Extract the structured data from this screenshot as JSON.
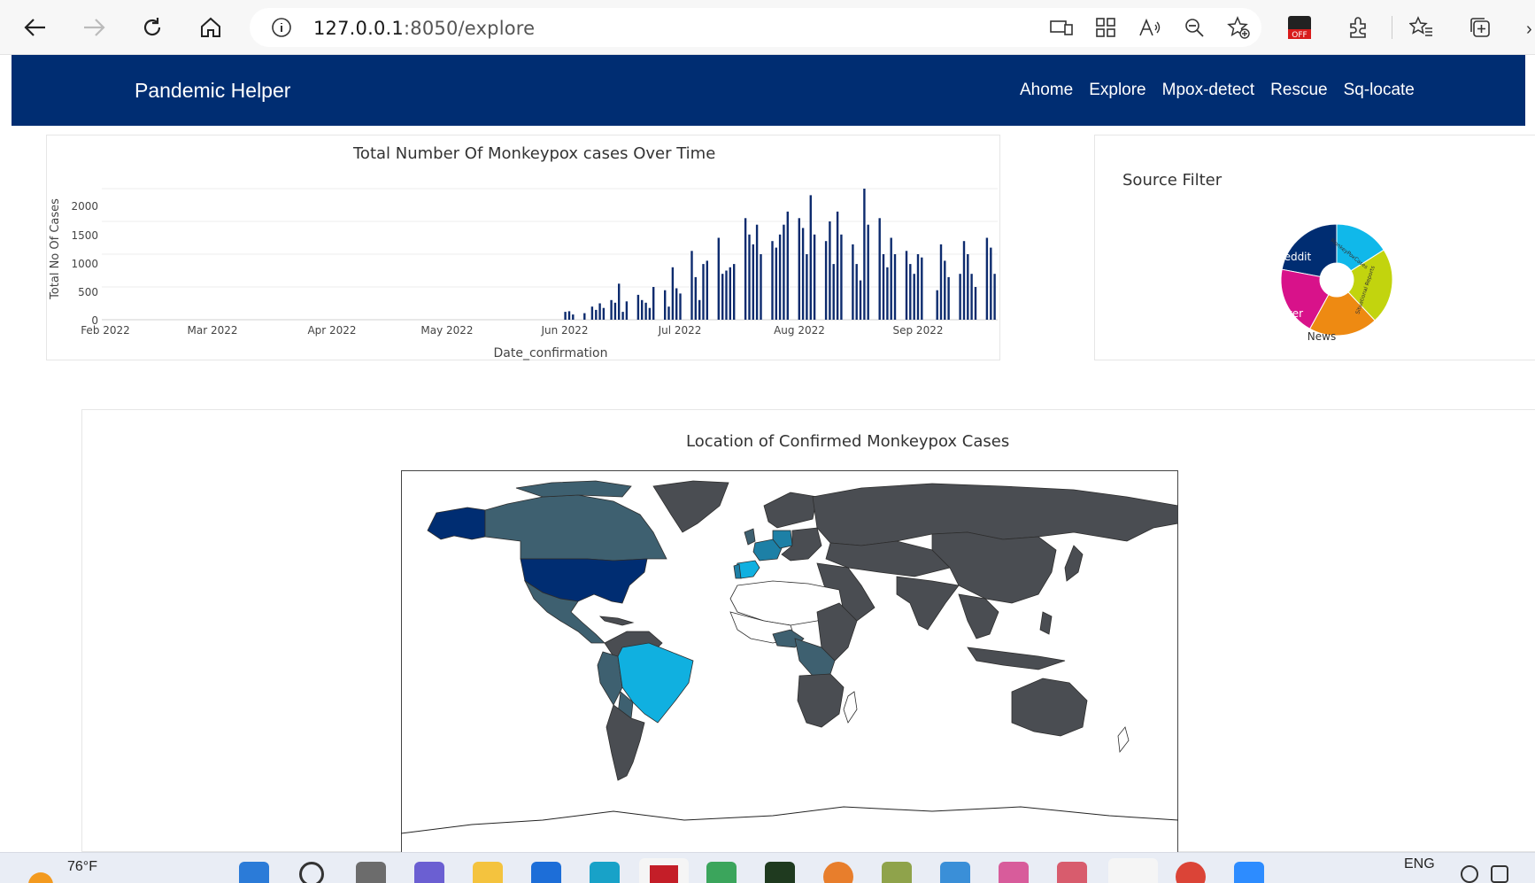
{
  "browser": {
    "url_host": "127.0.0.1",
    "url_rest": ":8050/explore",
    "ext_badge": "OFF"
  },
  "navbar": {
    "brand": "Pandemic Helper",
    "links": [
      "Ahome",
      "Explore",
      "Mpox-detect",
      "Rescue",
      "Sq-locate"
    ]
  },
  "timeline": {
    "title": "Total Number Of Monkeypox cases Over Time",
    "xlabel": "Date_confirmation",
    "ylabel": "Total No Of Cases",
    "yticks": [
      "0",
      "500",
      "1000",
      "1500",
      "2000"
    ],
    "xticks": [
      "Feb 2022",
      "Mar 2022",
      "Apr 2022",
      "May 2022",
      "Jun 2022",
      "Jul 2022",
      "Aug 2022",
      "Sep 2022"
    ]
  },
  "source_filter": {
    "title": "Source Filter",
    "labels": [
      "Reddit",
      "MonkeyPoxCases",
      "Situational Reports",
      "News",
      "Twitter"
    ]
  },
  "map": {
    "title": "Location of Confirmed Monkeypox Cases"
  },
  "taskbar": {
    "weather": "76°F",
    "lang": "ENG"
  },
  "chart_data": [
    {
      "type": "bar",
      "title": "Total Number Of Monkeypox cases Over Time",
      "xlabel": "Date_confirmation",
      "ylabel": "Total No Of Cases",
      "x_start": "2022-06-01",
      "ylim": [
        0,
        2000
      ],
      "x": [
        "2022-06-01",
        "2022-06-02",
        "2022-06-03",
        "2022-06-06",
        "2022-06-08",
        "2022-06-09",
        "2022-06-10",
        "2022-06-11",
        "2022-06-13",
        "2022-06-14",
        "2022-06-15",
        "2022-06-16",
        "2022-06-17",
        "2022-06-20",
        "2022-06-21",
        "2022-06-22",
        "2022-06-23",
        "2022-06-24",
        "2022-06-27",
        "2022-06-28",
        "2022-06-29",
        "2022-06-30",
        "2022-07-01",
        "2022-07-04",
        "2022-07-05",
        "2022-07-06",
        "2022-07-07",
        "2022-07-08",
        "2022-07-11",
        "2022-07-12",
        "2022-07-13",
        "2022-07-14",
        "2022-07-15",
        "2022-07-18",
        "2022-07-19",
        "2022-07-20",
        "2022-07-21",
        "2022-07-22",
        "2022-07-25",
        "2022-07-26",
        "2022-07-27",
        "2022-07-28",
        "2022-07-29",
        "2022-08-01",
        "2022-08-02",
        "2022-08-03",
        "2022-08-04",
        "2022-08-05",
        "2022-08-08",
        "2022-08-09",
        "2022-08-10",
        "2022-08-11",
        "2022-08-12",
        "2022-08-15",
        "2022-08-16",
        "2022-08-17",
        "2022-08-18",
        "2022-08-19",
        "2022-08-22",
        "2022-08-23",
        "2022-08-24",
        "2022-08-25",
        "2022-08-26",
        "2022-08-29",
        "2022-08-30",
        "2022-08-31",
        "2022-09-01",
        "2022-09-02",
        "2022-09-06",
        "2022-09-07",
        "2022-09-08",
        "2022-09-09",
        "2022-09-12",
        "2022-09-13",
        "2022-09-14",
        "2022-09-15",
        "2022-09-16",
        "2022-09-19",
        "2022-09-20",
        "2022-09-21"
      ],
      "values": [
        120,
        130,
        80,
        100,
        200,
        150,
        250,
        180,
        300,
        260,
        550,
        120,
        280,
        380,
        300,
        260,
        180,
        500,
        450,
        200,
        800,
        480,
        400,
        1050,
        650,
        300,
        850,
        900,
        1250,
        700,
        750,
        800,
        850,
        1550,
        1300,
        1150,
        1450,
        1000,
        1200,
        1100,
        1300,
        1450,
        1650,
        1550,
        1400,
        1000,
        1900,
        1300,
        1200,
        1500,
        850,
        1650,
        1300,
        1150,
        850,
        600,
        2000,
        1450,
        1550,
        1000,
        800,
        1250,
        1000,
        1050,
        850,
        700,
        1000,
        950,
        450,
        1150,
        900,
        650,
        700,
        1200,
        1000,
        700,
        500,
        1250,
        1100,
        700
      ]
    },
    {
      "type": "pie",
      "title": "Source Filter",
      "categories": [
        "Reddit",
        "MonkeyPoxCases",
        "Situational Reports",
        "News",
        "Twitter"
      ],
      "values": [
        22,
        16,
        22,
        20,
        20
      ]
    }
  ]
}
